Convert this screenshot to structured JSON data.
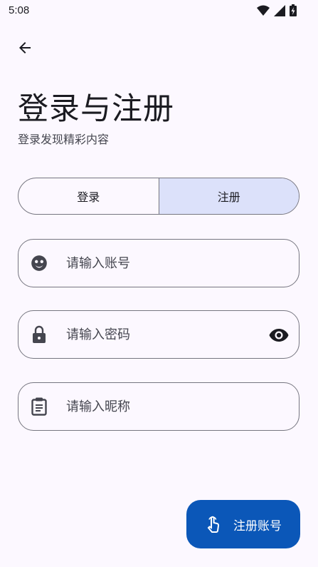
{
  "status_bar": {
    "time": "5:08",
    "icons": [
      "wifi-icon",
      "signal-icon",
      "battery-charging-icon"
    ]
  },
  "header": {
    "back_icon": "arrow-back-icon",
    "title": "登录与注册",
    "subtitle": "登录发现精彩内容"
  },
  "tabs": [
    {
      "label": "登录",
      "selected": false
    },
    {
      "label": "注册",
      "selected": true
    }
  ],
  "form": {
    "account": {
      "placeholder": "请输入账号",
      "value": "",
      "icon": "face-icon"
    },
    "password": {
      "placeholder": "请输入密码",
      "value": "",
      "icon": "lock-icon",
      "toggle_icon": "eye-icon"
    },
    "nickname": {
      "placeholder": "请输入昵称",
      "value": "",
      "icon": "clipboard-icon"
    }
  },
  "fab": {
    "label": "注册账号",
    "icon": "touch-icon"
  },
  "colors": {
    "background": "#FCF8FF",
    "selected_tab": "#DCE1FA",
    "primary": "#0B57B8",
    "outline": "#767680"
  }
}
